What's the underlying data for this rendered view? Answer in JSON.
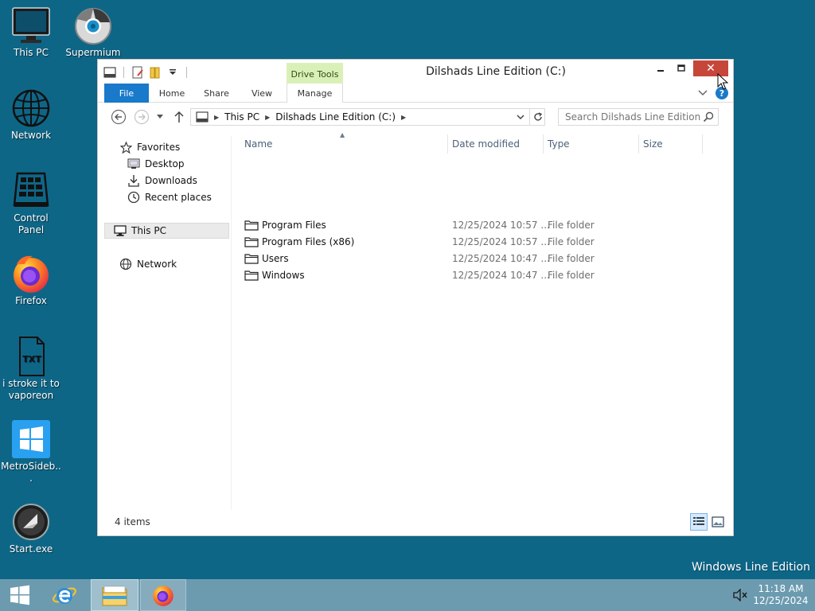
{
  "desktop": {
    "icons": [
      {
        "label": "This PC",
        "icon": "monitor-icon"
      },
      {
        "label": "Supermium",
        "icon": "supermium-browser-icon"
      },
      {
        "label": "Network",
        "icon": "globe-icon"
      },
      {
        "label": "Control Panel",
        "icon": "control-panel-icon"
      },
      {
        "label": "Firefox",
        "icon": "firefox-icon"
      },
      {
        "label": "i stroke it to vaporeon",
        "icon": "txt-file-icon"
      },
      {
        "label": "MetroSideb...",
        "icon": "metro-windows-logo-icon"
      },
      {
        "label": "Start.exe",
        "icon": "start-exe-icon"
      }
    ],
    "watermark": "Windows Line Edition"
  },
  "window": {
    "title": "Dilshads Line Edition (C:)",
    "contextual_group": "Drive Tools",
    "close_symbol": "✕",
    "ribbon_tabs": {
      "file": "File",
      "home": "Home",
      "share": "Share",
      "view": "View",
      "manage": "Manage"
    },
    "address": {
      "crumbs": [
        "This PC",
        "Dilshads Line Edition (C:)"
      ]
    },
    "search": {
      "placeholder": "Search Dilshads Line Edition (..."
    },
    "nav_pane": {
      "favorites": "Favorites",
      "desktop": "Desktop",
      "downloads": "Downloads",
      "recent": "Recent places",
      "this_pc": "This PC",
      "network": "Network"
    },
    "columns": {
      "name": "Name",
      "date": "Date modified",
      "type": "Type",
      "size": "Size"
    },
    "files": [
      {
        "name": "Program Files",
        "date": "12/25/2024 10:57 ...",
        "type": "File folder"
      },
      {
        "name": "Program Files (x86)",
        "date": "12/25/2024 10:57 ...",
        "type": "File folder"
      },
      {
        "name": "Users",
        "date": "12/25/2024 10:47 ...",
        "type": "File folder"
      },
      {
        "name": "Windows",
        "date": "12/25/2024 10:47 ...",
        "type": "File folder"
      }
    ],
    "status": {
      "count": "4 items"
    }
  },
  "taskbar": {
    "time": "11:18 AM",
    "date": "12/25/2024"
  },
  "colors": {
    "desktop_bg": "#0e6687",
    "taskbar_bg": "#6c9bb0",
    "file_tab": "#1979ca",
    "drive_tools": "#d9f1b9",
    "close_button": "#c7463a"
  }
}
